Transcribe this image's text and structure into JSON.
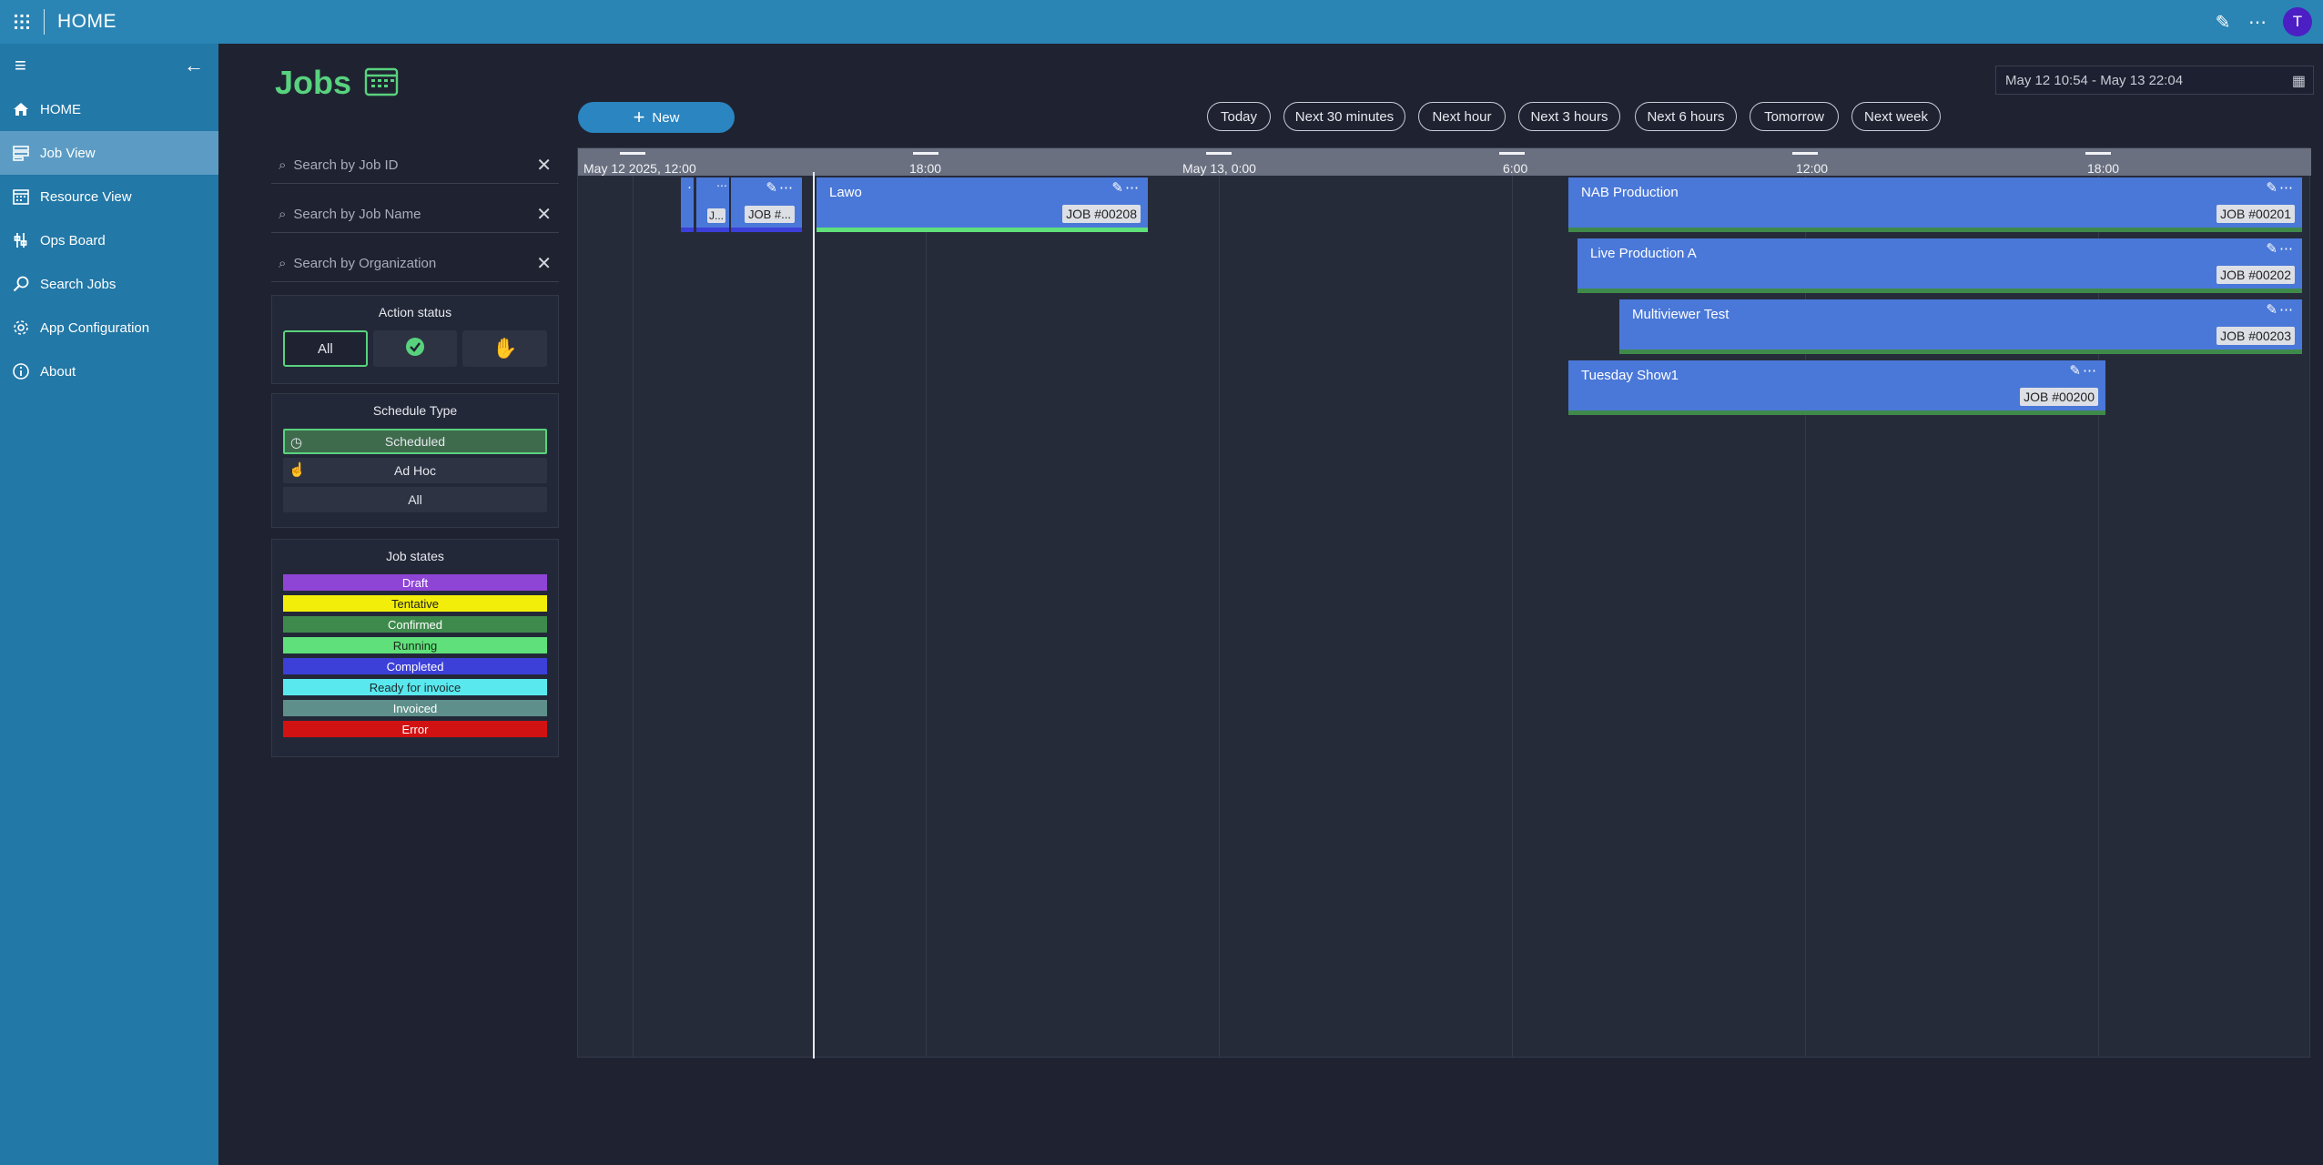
{
  "app": {
    "title": "HOME",
    "avatar_initial": "T"
  },
  "sidebar": {
    "items": [
      {
        "label": "HOME",
        "icon": "home-icon"
      },
      {
        "label": "Job View",
        "icon": "job-view-icon"
      },
      {
        "label": "Resource View",
        "icon": "calendar-icon"
      },
      {
        "label": "Ops Board",
        "icon": "ops-board-icon"
      },
      {
        "label": "Search Jobs",
        "icon": "search-icon"
      },
      {
        "label": "App Configuration",
        "icon": "gear-icon"
      },
      {
        "label": "About",
        "icon": "info-icon"
      }
    ]
  },
  "page": {
    "title": "Jobs",
    "date_range": "May 12 10:54 - May 13 22:04",
    "new_label": "New"
  },
  "quick_ranges": [
    "Today",
    "Next 30 minutes",
    "Next hour",
    "Next 3 hours",
    "Next 6 hours",
    "Tomorrow",
    "Next week"
  ],
  "filters": {
    "search_job_id": "Search by Job ID",
    "search_job_name": "Search by Job Name",
    "search_org": "Search by Organization",
    "action_status": {
      "title": "Action status",
      "all": "All"
    },
    "schedule_type": {
      "title": "Schedule Type",
      "scheduled": "Scheduled",
      "adhoc": "Ad Hoc",
      "all": "All"
    },
    "job_states": {
      "title": "Job states",
      "states": [
        {
          "label": "Draft",
          "color": "#8e45d6",
          "text": "#ffffff"
        },
        {
          "label": "Tentative",
          "color": "#f2ee0a",
          "text": "#222222"
        },
        {
          "label": "Confirmed",
          "color": "#3e8a4c",
          "text": "#ffffff"
        },
        {
          "label": "Running",
          "color": "#5fe07a",
          "text": "#1a2a1a"
        },
        {
          "label": "Completed",
          "color": "#3c3fd8",
          "text": "#ffffff"
        },
        {
          "label": "Ready for invoice",
          "color": "#5ae8ef",
          "text": "#1a2a2a"
        },
        {
          "label": "Invoiced",
          "color": "#5e8f8a",
          "text": "#ffffff"
        },
        {
          "label": "Error",
          "color": "#d11212",
          "text": "#ffffff"
        }
      ]
    }
  },
  "timeline": {
    "ticks": [
      "May 12 2025, 12:00",
      "18:00",
      "May 13, 0:00",
      "6:00",
      "12:00",
      "18:00"
    ],
    "jobs": [
      {
        "name": "",
        "id": "",
        "status": "Completed"
      },
      {
        "name": "",
        "id": "J...",
        "status": "Completed"
      },
      {
        "name": "",
        "id": "JOB #...",
        "status": "Completed"
      },
      {
        "name": "Lawo",
        "id": "JOB #00208",
        "status": "Running"
      },
      {
        "name": "NAB Production",
        "id": "JOB #00201",
        "status": "Confirmed"
      },
      {
        "name": "Live Production A",
        "id": "JOB #00202",
        "status": "Confirmed"
      },
      {
        "name": "Multiviewer Test",
        "id": "JOB #00203",
        "status": "Confirmed"
      },
      {
        "name": "Tuesday Show1",
        "id": "JOB #00200",
        "status": "Confirmed"
      }
    ]
  }
}
